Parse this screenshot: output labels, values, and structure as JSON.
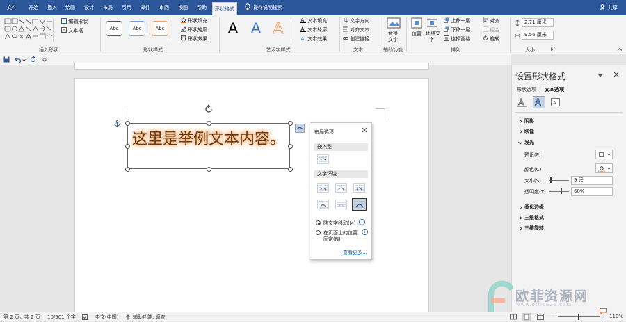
{
  "tabs": [
    "文件",
    "开始",
    "插入",
    "绘图",
    "设计",
    "布局",
    "引用",
    "邮件",
    "审阅",
    "视图",
    "帮助",
    "形状格式"
  ],
  "active_tab": "形状格式",
  "tell_me": "操作说明搜索",
  "share": "共享",
  "ribbon": {
    "insert_shapes": {
      "label": "插入形状",
      "edit_shape": "编辑形状",
      "text_box": "文本框"
    },
    "shape_styles": {
      "label": "形状样式",
      "preset": "Abc",
      "fill": "形状填充",
      "outline": "形状轮廓",
      "effects": "形状效果"
    },
    "wordart": {
      "label": "艺术字样式",
      "letter": "A",
      "text_fill": "文本填充",
      "text_outline": "文本轮廓",
      "text_effects": "文本效果"
    },
    "text": {
      "label": "文本",
      "direction": "文字方向",
      "align": "对齐文本",
      "link": "创建链接"
    },
    "accessibility": {
      "label": "辅助功能",
      "alt_text_1": "替换",
      "alt_text_2": "文字"
    },
    "arrange": {
      "label": "排列",
      "position": "位置",
      "wrap_1": "环绕文",
      "wrap_2": "字",
      "bring_forward": "上移一层",
      "send_backward": "下移一层",
      "selection_pane": "选择窗格",
      "align": "对齐",
      "group": "组合",
      "rotate": "旋转"
    },
    "size": {
      "label": "大小",
      "height": "2.71 厘米",
      "width": "9.56 厘米"
    }
  },
  "document": {
    "textbox_text": "这里是举例文本内容。"
  },
  "layout_popup": {
    "title": "布局选项",
    "inline_header": "嵌入型",
    "wrap_header": "文字环绕",
    "move_with_text": "随文字移动(M)",
    "fix_position_1": "在页面上的位置",
    "fix_position_2": "固定(N)",
    "see_more": "查看更多..."
  },
  "pane": {
    "title": "设置形状格式",
    "tab_shape": "形状选项",
    "tab_text": "文本选项",
    "sections": {
      "shadow": "阴影",
      "reflection": "映像",
      "glow": "发光",
      "soft_edges": "柔化边缘",
      "threed_format": "三维格式",
      "threed_rotation": "三维旋转"
    },
    "glow": {
      "preset_label": "预设(P)",
      "color_label": "颜色(C)",
      "size_label": "大小(S)",
      "size_value": "9 磅",
      "transparency_label": "透明度(T)",
      "transparency_value": "60%"
    }
  },
  "status": {
    "page": "第 2 页，共 2 页",
    "words": "10/501 个字",
    "language": "中文(中国)",
    "accessibility": "辅助功能: 调查",
    "zoom": "110%"
  },
  "watermark": {
    "brand": "欧菲资源网",
    "url": "www.office26.com"
  },
  "colors": {
    "accent": "#2b579a",
    "glow": "#f0b27a",
    "text_fill": "#6a3b12",
    "wordart_blue": "#3c78c8",
    "wordart_orange": "#f3a46b"
  }
}
